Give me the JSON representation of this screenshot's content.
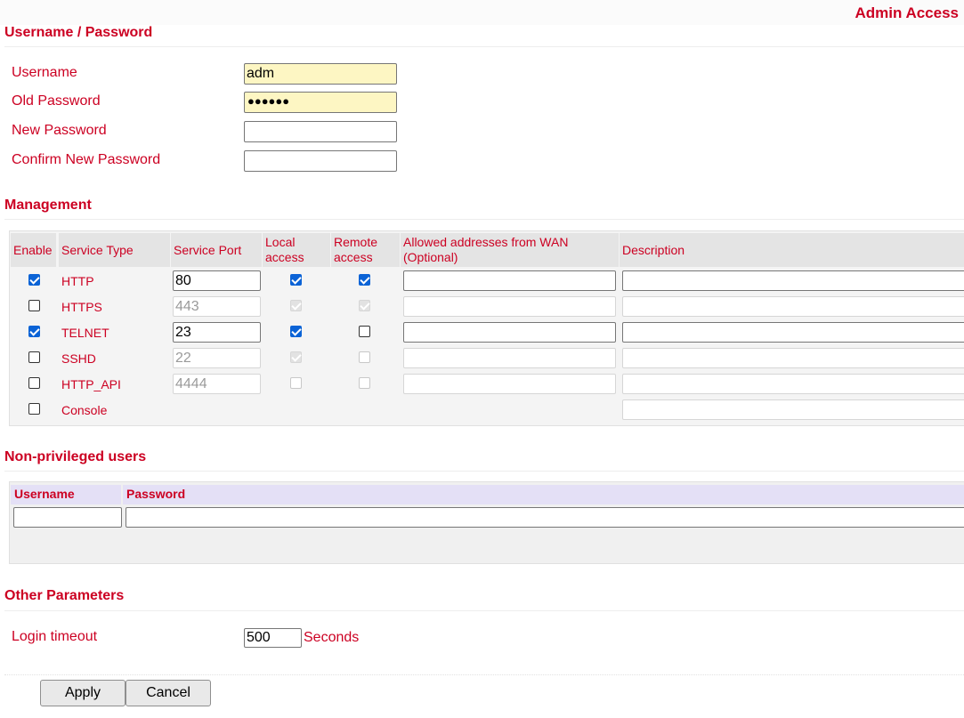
{
  "page_title": "Admin Access",
  "credentials": {
    "title": "Username / Password",
    "username_label": "Username",
    "username_value": "adm",
    "old_password_label": "Old Password",
    "old_password_mask": "●●●●●●",
    "new_password_label": "New Password",
    "new_password_value": "",
    "confirm_password_label": "Confirm New Password",
    "confirm_password_value": ""
  },
  "management": {
    "title": "Management",
    "headers": {
      "enable": "Enable",
      "service_type": "Service Type",
      "service_port": "Service Port",
      "local_access_1": "Local",
      "local_access_2": "access",
      "remote_access_1": "Remote",
      "remote_access_2": "access",
      "allowed_1": "Allowed addresses from WAN",
      "allowed_2": "(Optional)",
      "description": "Description"
    },
    "rows": [
      {
        "service": "HTTP",
        "enabled": true,
        "port": "80",
        "local": true,
        "remote": true
      },
      {
        "service": "HTTPS",
        "enabled": false,
        "port": "443",
        "local": true,
        "remote": true
      },
      {
        "service": "TELNET",
        "enabled": true,
        "port": "23",
        "local": true,
        "remote": false
      },
      {
        "service": "SSHD",
        "enabled": false,
        "port": "22",
        "local": true,
        "remote": false
      },
      {
        "service": "HTTP_API",
        "enabled": false,
        "port": "4444",
        "local": false,
        "remote": false
      },
      {
        "service": "Console",
        "enabled": false
      }
    ]
  },
  "non_privileged": {
    "title": "Non-privileged users",
    "username_header": "Username",
    "password_header": "Password",
    "username_value": "",
    "password_value": ""
  },
  "other": {
    "title": "Other Parameters",
    "login_timeout_label": "Login timeout",
    "login_timeout_value": "500",
    "login_timeout_unit": "Seconds"
  },
  "buttons": {
    "apply": "Apply",
    "cancel": "Cancel"
  },
  "colors": {
    "accent": "#cc0022",
    "checkbox_checked": "#0b63d6",
    "autofill_yellow": "#fdf6c3"
  }
}
